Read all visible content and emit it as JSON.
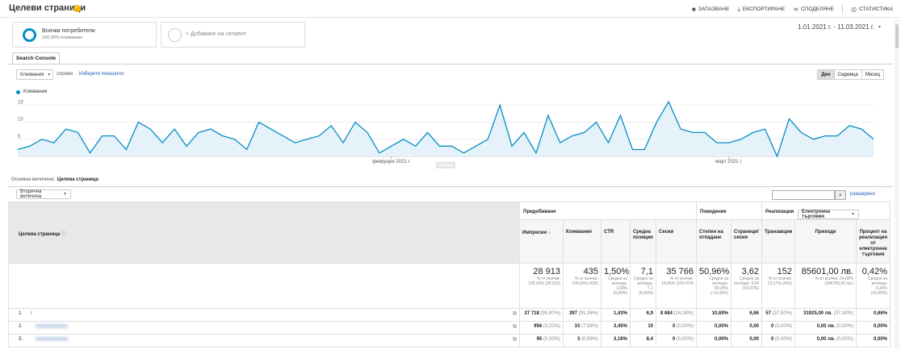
{
  "header": {
    "title": "Целеви страници",
    "toolbar": [
      {
        "label": "ЗАПАЗВАНЕ",
        "icon": "save-icon",
        "glyph": "■"
      },
      {
        "label": "ЕКСПОРТИРАНЕ",
        "icon": "export-icon",
        "glyph": "⤓"
      },
      {
        "label": "СПОДЕЛЯНЕ",
        "icon": "share-icon",
        "glyph": "⋖"
      },
      {
        "label": "СТАТИСТИКА",
        "icon": "insights-icon",
        "glyph": "◎"
      }
    ]
  },
  "segments": {
    "all_title": "Всички потребители",
    "all_sub": "100,00% Кликвания",
    "add_label": "+ Добавяне на сегмент"
  },
  "date_range": "1.01.2021 г. - 11.03.2021 г.",
  "tab": "Search Console",
  "controls": {
    "metric": "Кликвания",
    "versus": "спрямо",
    "pick_metric": "Изберете показател",
    "periods": [
      "Ден",
      "Седмица",
      "Месец"
    ],
    "active_period": "Ден"
  },
  "chart_data": {
    "type": "line",
    "series": [
      {
        "name": "Кликвания",
        "color": "#058dc7",
        "values": [
          2,
          3,
          5,
          4,
          8,
          7,
          1,
          6,
          6,
          2,
          10,
          8,
          4,
          8,
          3,
          7,
          8,
          6,
          5,
          2,
          10,
          8,
          6,
          4,
          5,
          6,
          9,
          4,
          10,
          7,
          1,
          3,
          5,
          3,
          7,
          3,
          3,
          1,
          3,
          5,
          15,
          3,
          7,
          1,
          12,
          4,
          6,
          7,
          10,
          4,
          12,
          2,
          2,
          10,
          16,
          8,
          7,
          7,
          4,
          4,
          5,
          7,
          8,
          0,
          11,
          7,
          5,
          6,
          6,
          9,
          8,
          5
        ],
        "labels": [
          "1.01.2021 г.",
          "2.01.2021 г.",
          "3.01.2021 г.",
          "4.01.2021 г.",
          "5.01.2021 г.",
          "6.01.2021 г.",
          "7.01.2021 г.",
          "8.01.2021 г.",
          "9.01.2021 г.",
          "10.01.2021 г.",
          "11.01.2021 г.",
          "12.01.2021 г.",
          "13.01.2021 г.",
          "14.01.2021 г.",
          "15.01.2021 г.",
          "16.01.2021 г.",
          "17.01.2021 г.",
          "18.01.2021 г.",
          "19.01.2021 г.",
          "20.01.2021 г.",
          "21.01.2021 г.",
          "22.01.2021 г.",
          "23.01.2021 г.",
          "24.01.2021 г.",
          "25.01.2021 г.",
          "26.01.2021 г.",
          "27.01.2021 г.",
          "28.01.2021 г.",
          "29.01.2021 г.",
          "30.01.2021 г.",
          "31.01.2021 г.",
          "1.02.2021 г.",
          "2.02.2021 г.",
          "3.02.2021 г.",
          "4.02.2021 г.",
          "5.02.2021 г.",
          "6.02.2021 г.",
          "7.02.2021 г.",
          "8.02.2021 г.",
          "9.02.2021 г.",
          "10.02.2021 г.",
          "11.02.2021 г.",
          "12.02.2021 г.",
          "13.02.2021 г.",
          "14.02.2021 г.",
          "15.02.2021 г.",
          "16.02.2021 г.",
          "17.02.2021 г.",
          "18.02.2021 г.",
          "19.02.2021 г.",
          "20.02.2021 г.",
          "21.02.2021 г.",
          "22.02.2021 г.",
          "23.02.2021 г.",
          "24.02.2021 г.",
          "25.02.2021 г.",
          "26.02.2021 г.",
          "27.02.2021 г.",
          "28.02.2021 г.",
          "1.03.2021 г.",
          "2.03.2021 г.",
          "3.03.2021 г.",
          "4.03.2021 г.",
          "5.03.2021 г.",
          "6.03.2021 г.",
          "7.03.2021 г.",
          "8.03.2021 г.",
          "9.03.2021 г.",
          "10.03.2021 г.",
          "11.03.2021 г.",
          "12.03.2021 г.",
          "13.03.2021 г."
        ]
      }
    ],
    "y_ticks": [
      "5",
      "10",
      "15"
    ],
    "ylim": [
      0,
      17
    ],
    "x_ticks": [
      {
        "label": "февруари 2021 г.",
        "index": 31
      },
      {
        "label": "март 2021 г.",
        "index": 59
      }
    ],
    "grid": true
  },
  "dimension": {
    "label": "Основна величина:",
    "value": "Целева страница"
  },
  "secondary_dim": "Вторична величина",
  "search_placeholder": "",
  "advanced_label": "разширено",
  "table": {
    "dim_header": "Целева страница",
    "groups": {
      "acquisition": "Придобиване",
      "behavior": "Поведение",
      "conversions": "Реализации",
      "conversion_type": "Електронна търговия"
    },
    "columns": [
      "Импресии",
      "Кликвания",
      "CTR",
      "Средна позиция",
      "Сесии",
      "Степен на отпадане",
      "Страници/ сесия",
      "Транзакции",
      "Приходи",
      "Процент на реализация от електронна търговия"
    ],
    "totals": [
      {
        "big": "28 913",
        "sub": "% от всички: 100,00% (28 913)"
      },
      {
        "big": "435",
        "sub": "% от всички: 100,00% (435)"
      },
      {
        "big": "1,50%",
        "sub": "Средно за изгледа: 1,50% (0,00%)"
      },
      {
        "big": "7,1",
        "sub": "Средно за изгледа: 7,1 (0,00%)"
      },
      {
        "big": "35 766",
        "sub": "% от всички: 18,45% (193 874)"
      },
      {
        "big": "50,96%",
        "sub": "Средно за изгледа: 59,25% (-14,00%)"
      },
      {
        "big": "3,62",
        "sub": "Средно за изгледа: 3,04 (18,97%)"
      },
      {
        "big": "152",
        "sub": "% от всички: 23,17% (656)"
      },
      {
        "big": "85601,00 лв.",
        "sub": "% от всички: 24,69% (346783,00 лв.)"
      },
      {
        "big": "0,42%",
        "sub": "Средно за изгледа: 0,34% (25,60%)"
      }
    ],
    "rows": [
      {
        "num": "1.",
        "page": "/",
        "cells": [
          [
            "27 718",
            "(95,87%)"
          ],
          [
            "397",
            "(91,26%)"
          ],
          [
            "1,43%",
            ""
          ],
          [
            "6,9",
            ""
          ],
          [
            "8 684",
            "(24,28%)"
          ],
          [
            "10,69%",
            ""
          ],
          [
            "6,66",
            ""
          ],
          [
            "57",
            "(37,50%)"
          ],
          [
            "31925,00 лв.",
            "(37,30%)"
          ],
          [
            "0,66%",
            ""
          ]
        ]
      },
      {
        "num": "2.",
        "page": "",
        "cells": [
          [
            "956",
            "(3,31%)"
          ],
          [
            "33",
            "(7,59%)"
          ],
          [
            "3,45%",
            ""
          ],
          [
            "10",
            ""
          ],
          [
            "0",
            "(0,00%)"
          ],
          [
            "0,00%",
            ""
          ],
          [
            "0,00",
            ""
          ],
          [
            "0",
            "(0,00%)"
          ],
          [
            "0,00 лв.",
            "(0,00%)"
          ],
          [
            "0,00%",
            ""
          ]
        ]
      },
      {
        "num": "3.",
        "page": "",
        "cells": [
          [
            "95",
            "(0,33%)"
          ],
          [
            "3",
            "(0,69%)"
          ],
          [
            "3,16%",
            ""
          ],
          [
            "8,4",
            ""
          ],
          [
            "0",
            "(0,00%)"
          ],
          [
            "0,00%",
            ""
          ],
          [
            "0,00",
            ""
          ],
          [
            "0",
            "(0,00%)"
          ],
          [
            "0,00 лв.",
            "(0,00%)"
          ],
          [
            "0,00%",
            ""
          ]
        ]
      }
    ]
  }
}
